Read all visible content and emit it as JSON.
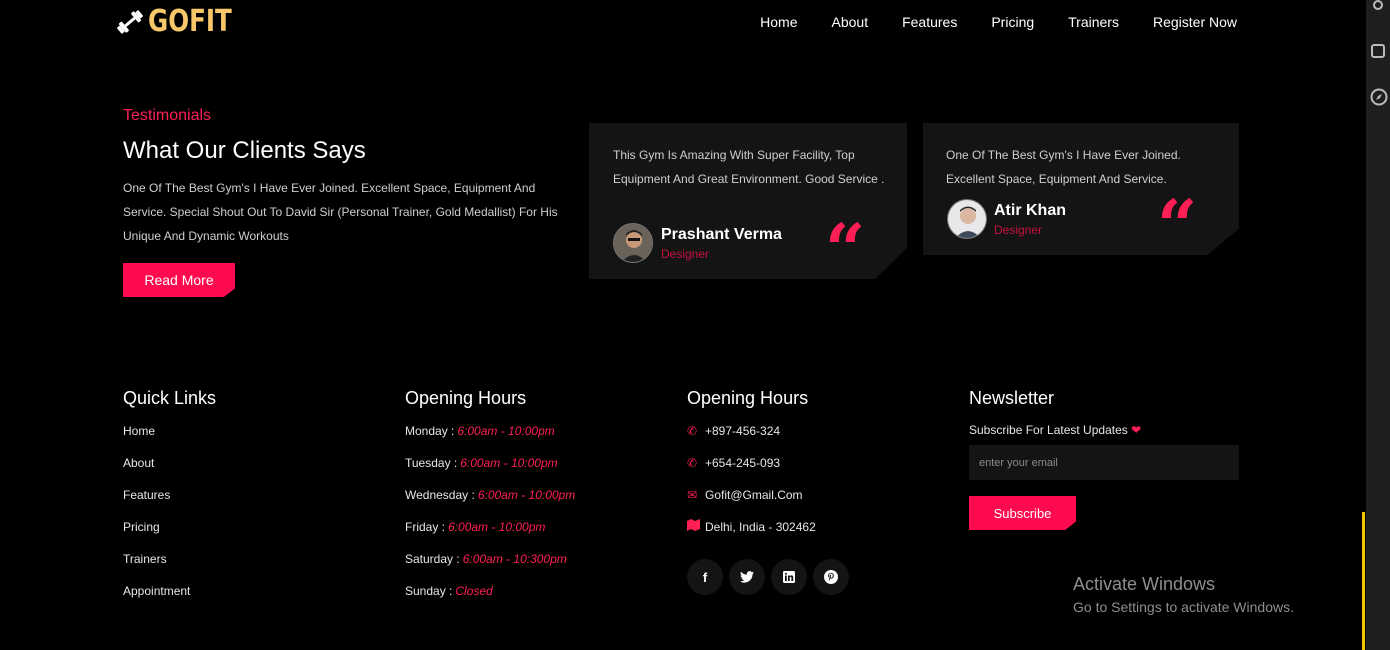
{
  "brand": {
    "name": "GOFIT",
    "logo_icon": "dumbbell-icon",
    "color": "#f7c76a"
  },
  "nav": [
    "Home",
    "About",
    "Features",
    "Pricing",
    "Trainers",
    "Register Now"
  ],
  "testimonials": {
    "subtitle": "Testimonials",
    "title": "What Our Clients Says",
    "description": "One Of The Best Gym's I Have Ever Joined. Excellent Space, Equipment And Service. Special Shout Out To David Sir (Personal Trainer, Gold Medallist) For His Unique And Dynamic Workouts",
    "read_more": "Read More",
    "cards": [
      {
        "text": "This Gym Is Amazing With Super Facility, Top Equipment And Great Environment. Good Service .",
        "name": "Prashant Verma",
        "role": "Designer"
      },
      {
        "text": "One Of The Best Gym's I Have Ever Joined. Excellent Space, Equipment And Service.",
        "name": "Atir Khan",
        "role": "Designer"
      }
    ],
    "quote_icon": "quote-icon"
  },
  "footer": {
    "quick_links": {
      "title": "Quick Links",
      "items": [
        "Home",
        "About",
        "Features",
        "Pricing",
        "Trainers",
        "Appointment"
      ]
    },
    "opening_hours": {
      "title": "Opening Hours",
      "items": [
        {
          "day": "Monday :",
          "time": "6:00am - 10:00pm"
        },
        {
          "day": "Tuesday :",
          "time": "6:00am - 10:00pm"
        },
        {
          "day": "Wednesday :",
          "time": "6:00am - 10:00pm"
        },
        {
          "day": "Friday :",
          "time": "6:00am - 10:00pm"
        },
        {
          "day": "Saturday :",
          "time": "6:00am - 10:300pm"
        },
        {
          "day": "Sunday :",
          "time": "Closed"
        }
      ]
    },
    "contact": {
      "title": "Opening Hours",
      "items": [
        {
          "icon": "phone-icon",
          "text": "+897-456-324"
        },
        {
          "icon": "phone-icon",
          "text": "+654-245-093"
        },
        {
          "icon": "envelope-icon",
          "text": "Gofit@Gmail.Com"
        },
        {
          "icon": "map-icon",
          "text": "Delhi, India - 302462"
        }
      ],
      "socials": [
        "facebook-icon",
        "twitter-icon",
        "linkedin-icon",
        "pinterest-icon"
      ]
    },
    "newsletter": {
      "title": "Newsletter",
      "text": "Subscribe For Latest Updates",
      "placeholder": "enter your email",
      "button": "Subscribe"
    }
  },
  "watermark": {
    "line1": "Activate Windows",
    "line2": "Go to Settings to activate Windows."
  },
  "colors": {
    "accent": "#ff0a4f",
    "background": "#000000",
    "card": "#141414"
  }
}
